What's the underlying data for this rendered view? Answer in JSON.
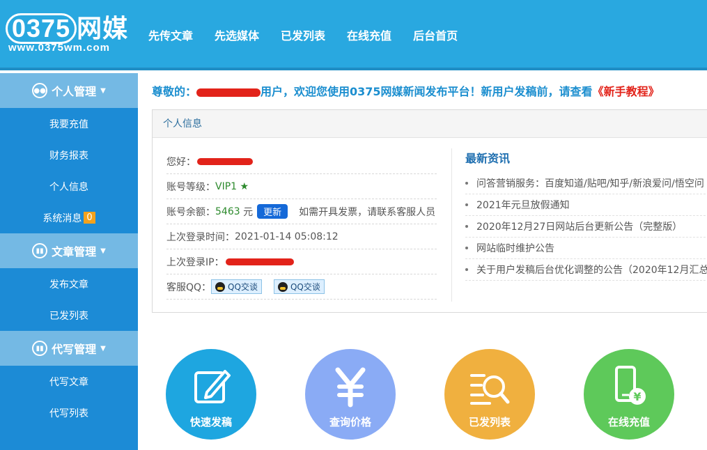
{
  "header": {
    "logo_number": "0375",
    "logo_text": "网媒",
    "logo_url": "www.0375wm.com",
    "nav": [
      "先传文章",
      "先选媒体",
      "已发列表",
      "在线充值",
      "后台首页"
    ]
  },
  "sidebar": {
    "groups": [
      {
        "title": "个人管理",
        "items": [
          "我要充值",
          "财务报表",
          "个人信息",
          "系统消息"
        ]
      },
      {
        "title": "文章管理",
        "items": [
          "发布文章",
          "已发列表"
        ]
      },
      {
        "title": "代写管理",
        "items": [
          "代写文章",
          "代写列表"
        ]
      }
    ],
    "message_count": "0"
  },
  "welcome": {
    "prefix": "尊敬的：",
    "suffix": "用户，欢迎您使用0375网媒新闻发布平台！新用户发稿前，请查看",
    "link": "《新手教程》"
  },
  "panel": {
    "title": "个人信息",
    "greeting_label": "您好：",
    "level_label": "账号等级：",
    "level_value": "VIP1 ★",
    "balance_label": "账号余额：",
    "balance_value": "5463",
    "balance_unit": "元",
    "update_button": "更新",
    "invoice_note": "如需开具发票，请联系客服人员",
    "last_login_label": "上次登录时间：",
    "last_login_value": "2021-01-14 05:08:12",
    "last_ip_label": "上次登录IP：",
    "service_qq_label": "客服QQ：",
    "qq_button": "QQ交谈"
  },
  "news": {
    "title": "最新资讯",
    "items": [
      "问答营销服务：百度知道/贴吧/知乎/新浪爱问/悟空问",
      "2021年元旦放假通知",
      "2020年12月27日网站后台更新公告（完整版）",
      "网站临时维护公告",
      "关于用户发稿后台优化调整的公告（2020年12月汇总"
    ]
  },
  "tiles": [
    {
      "label": "快速发稿",
      "color": "#1ea6e0",
      "icon": "edit-icon"
    },
    {
      "label": "查询价格",
      "color": "#8aabf5",
      "icon": "yen-icon"
    },
    {
      "label": "已发列表",
      "color": "#f0b03f",
      "icon": "list-search-icon"
    },
    {
      "label": "在线充值",
      "color": "#5ec95a",
      "icon": "phone-recharge-icon"
    }
  ]
}
